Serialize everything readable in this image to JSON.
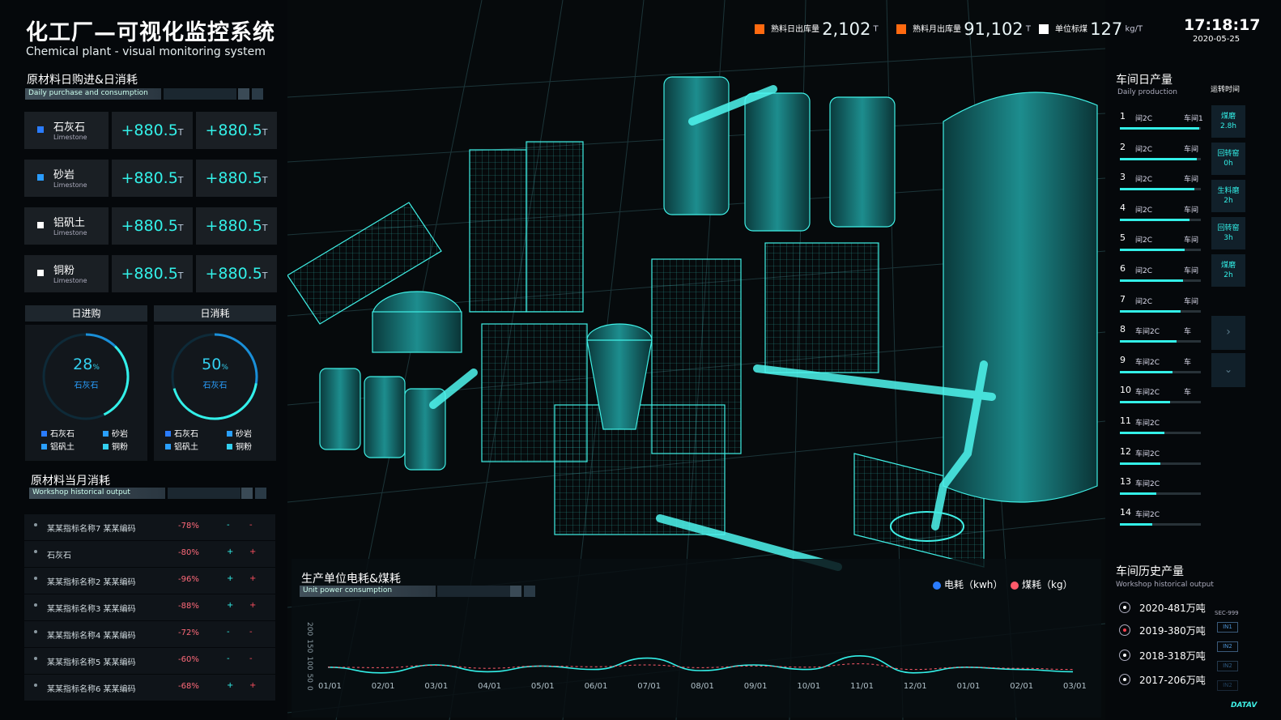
{
  "header": {
    "title": "化工厂—可视化监控系统",
    "subtitle": "Chemical plant - visual monitoring system",
    "time": "17:18:17",
    "date": "2020-05-25",
    "stats": [
      {
        "label": "熟料日出库量",
        "value": "2,102",
        "unit": "T",
        "color": "#ff6a10"
      },
      {
        "label": "熟料月出库量",
        "value": "91,102",
        "unit": "T",
        "color": "#ff6a10"
      },
      {
        "label": "单位标煤",
        "value": "127",
        "unit": "kg/T",
        "color": "#ffffff"
      }
    ]
  },
  "daily_section": {
    "title": "原材料日购进&日消耗",
    "subtitle": "Daily purchase and consumption",
    "materials": [
      {
        "name": "石灰石",
        "en": "Limestone",
        "in": "880.5",
        "out": "880.5",
        "sign": "+",
        "unit": "T",
        "color": "#2a7cff"
      },
      {
        "name": "砂岩",
        "en": "Limestone",
        "in": "880.5",
        "out": "880.5",
        "sign": "+",
        "unit": "T",
        "color": "#2a9cff"
      },
      {
        "name": "铝矾土",
        "en": "Limestone",
        "in": "880.5",
        "out": "880.5",
        "sign": "+",
        "unit": "T",
        "color": "#ffffff"
      },
      {
        "name": "铜粉",
        "en": "Limestone",
        "in": "880.5",
        "out": "880.5",
        "sign": "+",
        "unit": "T",
        "color": "#ffffff"
      }
    ]
  },
  "gauges": [
    {
      "head": "日进购",
      "value": "28",
      "unit": "%",
      "label": "石灰石",
      "percent": 28,
      "legend": [
        "石灰石",
        "砂岩",
        "铝矾土",
        "铜粉"
      ]
    },
    {
      "head": "日消耗",
      "value": "50",
      "unit": "%",
      "label": "石灰石",
      "percent": 50,
      "legend": [
        "石灰石",
        "砂岩",
        "铝矾土",
        "铜粉"
      ]
    }
  ],
  "legend_colors": [
    "#2a7cff",
    "#2aa0ff",
    "#2aa0ff",
    "#33d0f0"
  ],
  "monthly_section": {
    "title": "原材料当月消耗",
    "subtitle": "Workshop historical output",
    "rows": [
      {
        "name": "某某指标名称7 某某编码",
        "pct": "-78%",
        "s1": "-",
        "s2": "-"
      },
      {
        "name": "石灰石",
        "pct": "-80%",
        "s1": "+",
        "s2": "+"
      },
      {
        "name": "某某指标名称2 某某编码",
        "pct": "-96%",
        "s1": "+",
        "s2": "+"
      },
      {
        "name": "某某指标名称3 某某编码",
        "pct": "-88%",
        "s1": "+",
        "s2": "+"
      },
      {
        "name": "某某指标名称4 某某编码",
        "pct": "-72%",
        "s1": "-",
        "s2": "-"
      },
      {
        "name": "某某指标名称5 某某编码",
        "pct": "-60%",
        "s1": "-",
        "s2": "-"
      },
      {
        "name": "某某指标名称6 某某编码",
        "pct": "-68%",
        "s1": "+",
        "s2": "+"
      }
    ]
  },
  "daily_production": {
    "title": "车间日产量",
    "subtitle": "Daily production",
    "tab_title": "运转时间",
    "rows": [
      {
        "rank": "1",
        "name": "间2C",
        "ws": "车间1",
        "pct": 0.98
      },
      {
        "rank": "2",
        "name": "间2C",
        "ws": "车间",
        "pct": 0.95
      },
      {
        "rank": "3",
        "name": "间2C",
        "ws": "车间",
        "pct": 0.92
      },
      {
        "rank": "4",
        "name": "间2C",
        "ws": "车间",
        "pct": 0.86
      },
      {
        "rank": "5",
        "name": "间2C",
        "ws": "车间",
        "pct": 0.8
      },
      {
        "rank": "6",
        "name": "间2C",
        "ws": "车间",
        "pct": 0.78
      },
      {
        "rank": "7",
        "name": "间2C",
        "ws": "车间",
        "pct": 0.75
      },
      {
        "rank": "8",
        "name": "车间2C",
        "ws": "车",
        "pct": 0.7
      },
      {
        "rank": "9",
        "name": "车间2C",
        "ws": "车",
        "pct": 0.65
      },
      {
        "rank": "10",
        "name": "车间2C",
        "ws": "车",
        "pct": 0.62
      },
      {
        "rank": "11",
        "name": "车间2C",
        "ws": "",
        "pct": 0.55
      },
      {
        "rank": "12",
        "name": "车间2C",
        "ws": "",
        "pct": 0.5
      },
      {
        "rank": "13",
        "name": "车间2C",
        "ws": "",
        "pct": 0.45
      },
      {
        "rank": "14",
        "name": "车间2C",
        "ws": "",
        "pct": 0.4
      }
    ],
    "tabs": [
      {
        "label": "煤磨",
        "value": "2.8h"
      },
      {
        "label": "回转窑",
        "value": "0h"
      },
      {
        "label": "生料磨",
        "value": "2h"
      },
      {
        "label": "回转窑",
        "value": "3h"
      },
      {
        "label": "煤磨",
        "value": "2h"
      }
    ]
  },
  "history": {
    "title": "车间历史产量",
    "subtitle": "Workshop historical output",
    "years": [
      {
        "text": "2020-481万吨",
        "color": "#ffffff"
      },
      {
        "text": "2019-380万吨",
        "color": "#ff4050"
      },
      {
        "text": "2018-318万吨",
        "color": "#ffffff"
      },
      {
        "text": "2017-206万吨",
        "color": "#ffffff"
      }
    ],
    "tag_code": "SEC-999",
    "tags": [
      "IN1",
      "IN2",
      "IN2",
      "IN2"
    ]
  },
  "chart": {
    "title": "生产单位电耗&煤耗",
    "subtitle": "Unit power consumption",
    "legend": [
      {
        "name": "电耗（kwh）",
        "color": "#2a7cff"
      },
      {
        "name": "煤耗（kg）",
        "color": "#ff5a6a"
      }
    ],
    "yticks": [
      "200",
      "150",
      "100",
      "50",
      "0"
    ]
  },
  "chart_data": {
    "type": "line",
    "title": "生产单位电耗&煤耗",
    "x": [
      "01/01",
      "02/01",
      "03/01",
      "04/01",
      "05/01",
      "06/01",
      "07/01",
      "08/01",
      "09/01",
      "10/01",
      "11/01",
      "12/01",
      "01/01",
      "02/01",
      "03/01"
    ],
    "ylim": [
      0,
      200
    ],
    "series": [
      {
        "name": "电耗（kwh）",
        "color": "#33f0e8",
        "values": [
          40,
          15,
          50,
          20,
          45,
          30,
          80,
          25,
          50,
          30,
          90,
          15,
          40,
          30,
          20
        ]
      },
      {
        "name": "煤耗（kg）",
        "color": "#ff5a6a",
        "values": [
          40,
          38,
          48,
          35,
          45,
          42,
          50,
          38,
          45,
          40,
          55,
          30,
          40,
          35,
          30
        ]
      }
    ]
  },
  "brand": "DATAV"
}
